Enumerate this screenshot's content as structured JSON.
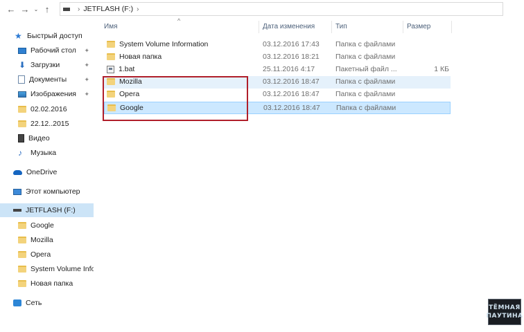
{
  "address_bar": {
    "back_icon": "←",
    "forward_icon": "→",
    "recent_icon": "⌄",
    "up_icon": "↑",
    "breadcrumb": [
      "JETFLASH (F:)"
    ]
  },
  "navigation_pane": {
    "items": [
      {
        "label": "Быстрый доступ",
        "icon": "star-icon",
        "pinned": false
      },
      {
        "label": "Рабочий стол",
        "icon": "desktop-icon",
        "pinned": true
      },
      {
        "label": "Загрузки",
        "icon": "downloads-icon",
        "pinned": true
      },
      {
        "label": "Документы",
        "icon": "documents-icon",
        "pinned": true
      },
      {
        "label": "Изображения",
        "icon": "pictures-icon",
        "pinned": true
      },
      {
        "label": "02.02.2016",
        "icon": "folder-icon",
        "pinned": false
      },
      {
        "label": "22.12..2015",
        "icon": "folder-icon",
        "pinned": false
      },
      {
        "label": "Видео",
        "icon": "video-icon",
        "pinned": false
      },
      {
        "label": "Музыка",
        "icon": "music-icon",
        "pinned": false
      },
      {
        "label": "OneDrive",
        "icon": "onedrive-icon",
        "pinned": false
      },
      {
        "label": "Этот компьютер",
        "icon": "computer-icon",
        "pinned": false
      },
      {
        "label": "JETFLASH (F:)",
        "icon": "drive-icon",
        "pinned": false,
        "selected": true
      },
      {
        "label": "Google",
        "icon": "folder-icon",
        "pinned": false
      },
      {
        "label": "Mozilla",
        "icon": "folder-icon",
        "pinned": false
      },
      {
        "label": "Opera",
        "icon": "folder-icon",
        "pinned": false
      },
      {
        "label": "System Volume Information",
        "icon": "folder-icon",
        "pinned": false
      },
      {
        "label": "Новая папка",
        "icon": "folder-icon",
        "pinned": false
      },
      {
        "label": "Сеть",
        "icon": "network-icon",
        "pinned": false
      }
    ]
  },
  "file_list": {
    "columns": {
      "name": "Имя",
      "date": "Дата изменения",
      "type": "Тип",
      "size": "Размер"
    },
    "rows": [
      {
        "name": "System Volume Information",
        "date": "03.12.2016 17:43",
        "type": "Папка с файлами",
        "size": "",
        "icon": "folder-icon"
      },
      {
        "name": "Новая папка",
        "date": "03.12.2016 18:21",
        "type": "Папка с файлами",
        "size": "",
        "icon": "folder-icon"
      },
      {
        "name": "1.bat",
        "date": "25.11.2016 4:17",
        "type": "Пакетный файл ...",
        "size": "1 КБ",
        "icon": "bat-file-icon"
      },
      {
        "name": "Mozilla",
        "date": "03.12.2016 18:47",
        "type": "Папка с файлами",
        "size": "",
        "icon": "folder-icon"
      },
      {
        "name": "Opera",
        "date": "03.12.2016 18:47",
        "type": "Папка с файлами",
        "size": "",
        "icon": "folder-icon"
      },
      {
        "name": "Google",
        "date": "03.12.2016 18:47",
        "type": "Папка с файлами",
        "size": "",
        "icon": "folder-icon"
      }
    ]
  },
  "watermark": {
    "line1": "ТЁМНАЯ",
    "line2": "ПАУТИНА"
  },
  "colors": {
    "selection": "#cce8ff",
    "hover": "#e5f1fb",
    "annotation_red": "#b01e2a"
  }
}
